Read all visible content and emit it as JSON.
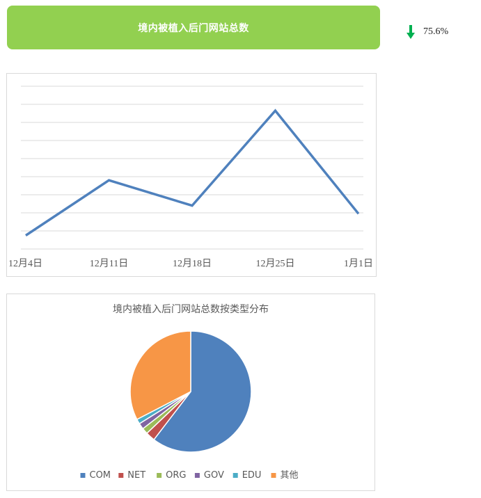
{
  "header": {
    "title": "境内被植入后门网站总数",
    "background_color": "#92d050"
  },
  "indicator": {
    "direction": "down",
    "icon": "arrow-down-icon",
    "color": "#00b050",
    "value": "75.6%"
  },
  "chart_data": [
    {
      "type": "line",
      "categories": [
        "12月4日",
        "12月11日",
        "12月18日",
        "12月25日",
        "1月1日"
      ],
      "series": [
        {
          "values": [
            1.5,
            7.6,
            4.8,
            15.3,
            3.9
          ],
          "color": "#4f81bd"
        }
      ],
      "ylim": [
        0,
        18
      ],
      "grid": true,
      "legend": "none"
    },
    {
      "type": "pie",
      "title": "境内被植入后门网站总数按类型分布",
      "categories": [
        "COM",
        "NET",
        "ORG",
        "GOV",
        "EDU",
        "其他"
      ],
      "values": [
        60.4,
        2.5,
        1.6,
        1.6,
        1.3,
        32.6
      ],
      "colors": [
        "#4f81bd",
        "#c0504d",
        "#9bbb59",
        "#8064a2",
        "#4bacc6",
        "#f79646"
      ],
      "legend": "bottom"
    }
  ]
}
